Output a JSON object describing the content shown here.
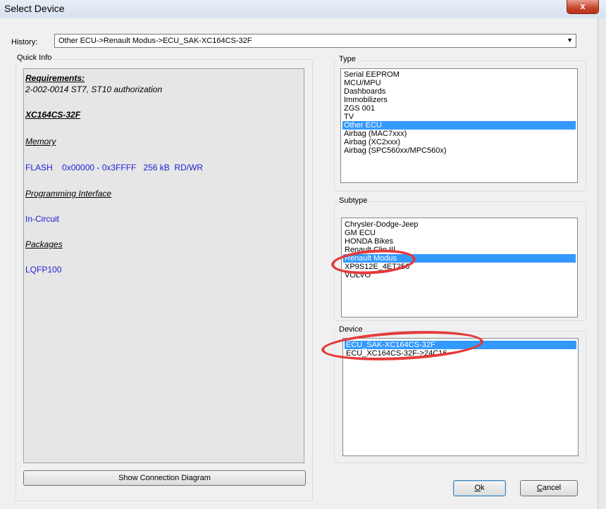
{
  "window": {
    "title": "Select Device",
    "close_symbol": "x"
  },
  "history": {
    "label": "History:",
    "value": "Other ECU->Renault Modus->ECU_SAK-XC164CS-32F",
    "arrow": "▼"
  },
  "quick_info": {
    "label": "Quick Info",
    "requirements_head": "Requirements:",
    "requirements_text": "2-002-0014  ST7, ST10 authorization",
    "chip": "XC164CS-32F",
    "memory_head": "Memory",
    "memory_text": "FLASH    0x00000 - 0x3FFFF   256 kB  RD/WR",
    "interface_head": "Programming Interface",
    "interface_text": "In-Circuit",
    "packages_head": "Packages",
    "packages_text": "LQFP100"
  },
  "type": {
    "label": "Type",
    "items": [
      "Serial EEPROM",
      "MCU/MPU",
      "Dashboards",
      "Immobilizers",
      "ZGS 001",
      "TV",
      "Other ECU",
      "Airbag (MAC7xxx)",
      "Airbag (XC2xxx)",
      "Airbag (SPC560xx/MPC560x)"
    ],
    "selected_index": 6
  },
  "subtype": {
    "label": "Subtype",
    "items": [
      "Chrysler-Dodge-Jeep",
      "GM ECU",
      "HONDA Bikes",
      "Renault Clio III",
      "Renault Modus",
      "XP9S12E_4ET256",
      "VOLVO"
    ],
    "selected_index": 4
  },
  "device": {
    "label": "Device",
    "items": [
      "ECU_SAK-XC164CS-32F",
      "ECU_XC164CS-32F->24C16"
    ],
    "selected_index": 0
  },
  "buttons": {
    "show_diagram": "Show Connection Diagram",
    "ok_hotkey": "O",
    "ok_rest": "k",
    "cancel_hotkey": "C",
    "cancel_rest": "ancel"
  },
  "colors": {
    "selection": "#3399ff",
    "info_text": "#2020d8",
    "annotation": "#e53a3a"
  }
}
